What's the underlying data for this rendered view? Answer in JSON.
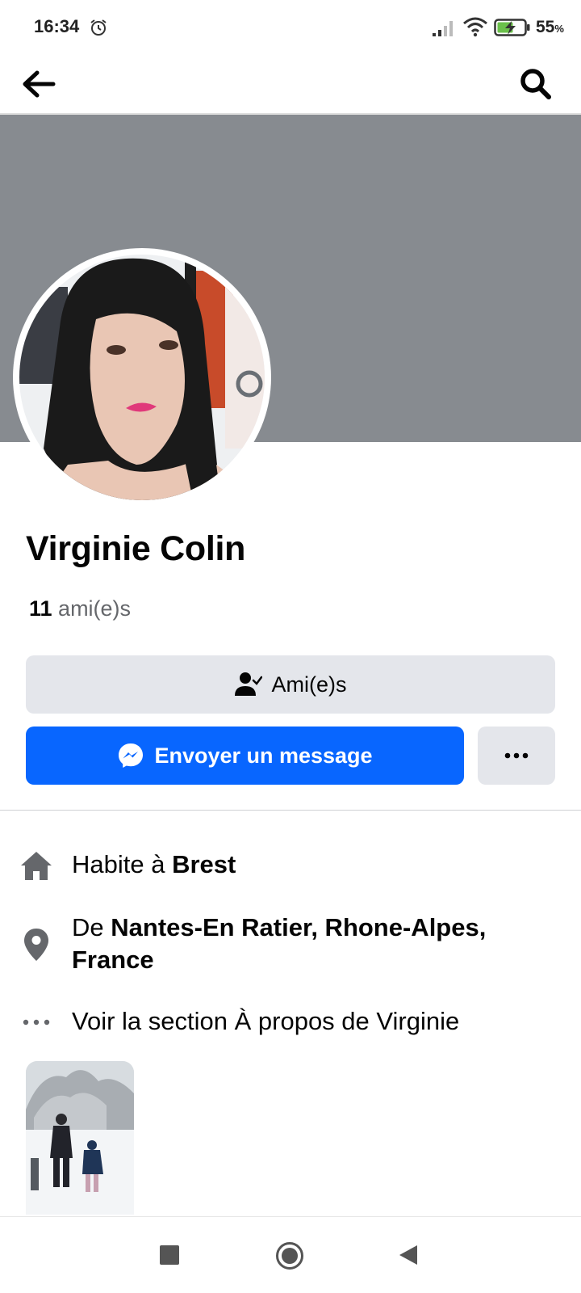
{
  "status_bar": {
    "time": "16:34",
    "battery_percent": "55",
    "battery_unit": "%",
    "icons": [
      "alarm-icon",
      "signal-icon",
      "wifi-icon",
      "battery-charging-icon"
    ]
  },
  "top_nav": {
    "back_icon": "arrow-left-icon",
    "search_icon": "search-icon"
  },
  "profile": {
    "name": "Virginie Colin",
    "friends_count": "11",
    "friends_label": " ami(e)s"
  },
  "actions": {
    "friends_button": "Ami(e)s",
    "message_button": "Envoyer un message",
    "more_icon": "more-dots-icon"
  },
  "intro": {
    "lives_in_prefix": "Habite à ",
    "lives_in_city": "Brest",
    "from_prefix": "De ",
    "from_place": "Nantes-En Ratier, Rhone-Alpes, France",
    "about_link": "Voir la section À propos de Virginie"
  },
  "colors": {
    "accent": "#0866ff",
    "cover": "#878b90",
    "secondary_button": "#e4e6eb",
    "secondary_text": "#65676b"
  },
  "system_nav": {
    "icons": [
      "recent-apps-icon",
      "home-icon",
      "back-triangle-icon"
    ]
  }
}
